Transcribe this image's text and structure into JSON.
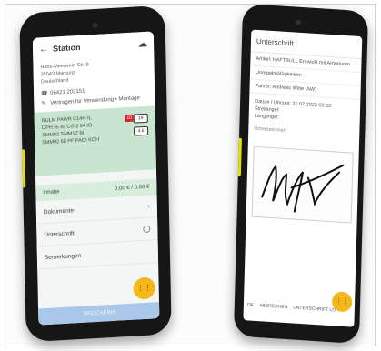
{
  "left_screen": {
    "title": "Station",
    "address_lines": [
      "Hans-Meerwein-Str. 8",
      "35043 Marburg",
      "Deutschland"
    ],
    "phone": "06421 202151",
    "usage": "Vertragen für Verwendung • Montage",
    "product_lines": [
      "RULM PAWR C14H-IL",
      "OPH (E.B) CO 2 64 IO",
      "SMM92 SMM1Z BI",
      "SMM92 68 PF PAOI KOH"
    ],
    "badges": {
      "red": "10",
      "d1": "19",
      "d2": "4.6"
    },
    "inhalt_label": "Inhalte",
    "inhalt_value": "0,00 € / 0,00 €",
    "row_documents": "Dokumente",
    "row_signature": "Unterschrift",
    "row_notes": "Bemerkungen",
    "footer_button": "SPEICHERN",
    "fab_label": "⋮⋮"
  },
  "right_screen": {
    "title": "Unterschrift",
    "artikel": "Artikel: HAFTBULL Entwickl mit Armaturen",
    "unregelm": "Unregelmäßigkeiten:",
    "fahrer": "Fahrer: Andreas Witte (AW)",
    "datum": "Datum / Uhrzeit: 31.07.2023 09:52",
    "strelaengel": "Streilangel:",
    "laengengel": "Längengel:",
    "unterzeichner": "Unterzeichner",
    "btn_ok": "OK",
    "btn_abbrechen": "ABBRECHEN",
    "btn_unterschrift": "UNTERSCHRIFT LÖ",
    "fab_label": "⋮⋮"
  },
  "colors": {
    "device_body": "#161616",
    "side_key": "#e3df00",
    "green_panel": "#c8e5cf",
    "fab": "#f5b81a",
    "footer_button": "#a9c7e8"
  }
}
